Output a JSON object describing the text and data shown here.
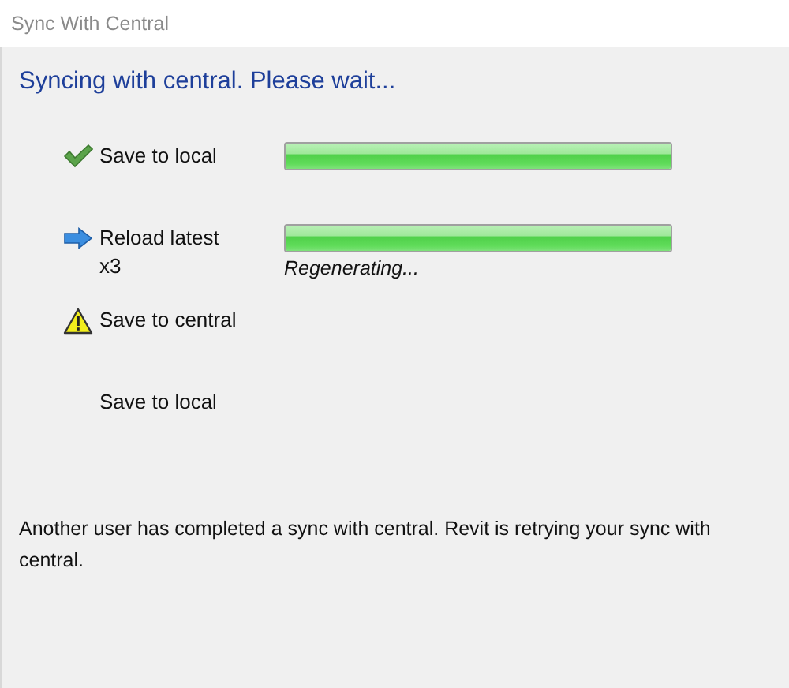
{
  "window": {
    "title": "Sync With Central"
  },
  "heading": "Syncing with central. Please wait...",
  "steps": [
    {
      "kind": "done",
      "label": "Save to local",
      "progress": {
        "level": 1
      }
    },
    {
      "kind": "current",
      "label": "Reload latest",
      "note": "x3",
      "progress": {
        "level": 1,
        "status": "Regenerating..."
      }
    },
    {
      "kind": "warning",
      "label": "Save to central"
    },
    {
      "kind": "pending",
      "label": "Save to local"
    }
  ],
  "message": "Another user has completed a sync with central. Revit is retrying your sync with central."
}
